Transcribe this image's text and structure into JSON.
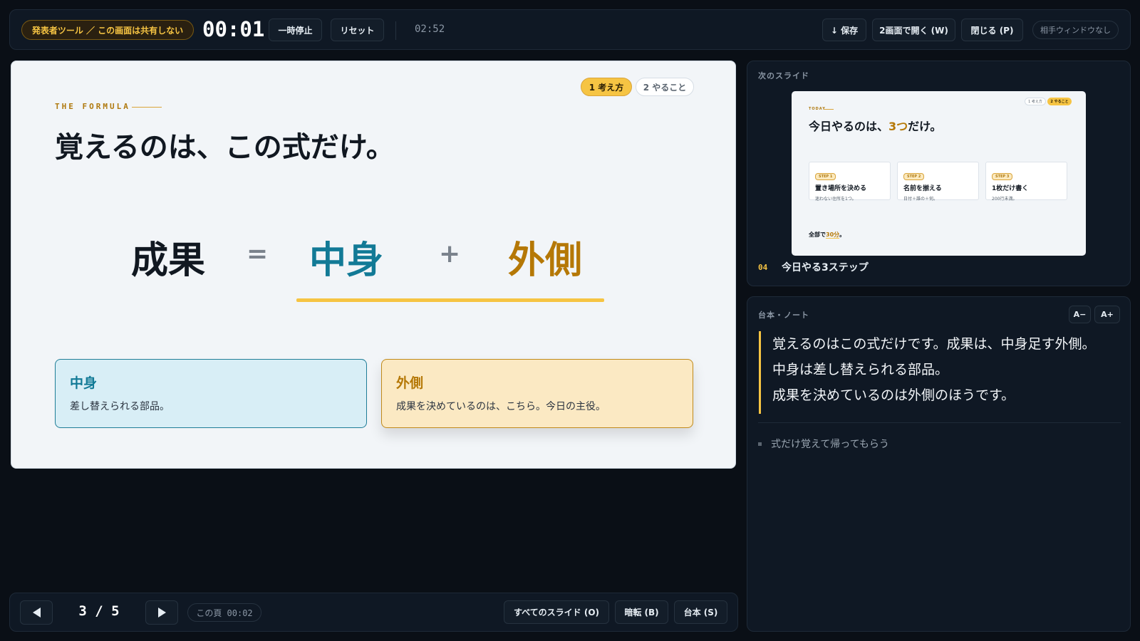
{
  "topbar": {
    "presenter_badge": "発表者ツール ／ この画面は共有しない",
    "timer": "00:01",
    "pause_label": "一時停止",
    "reset_label": "リセット",
    "elapsed": "02:52",
    "save_label": "↓ 保存",
    "open_two_screens_label": "2画面で開く (W)",
    "close_label": "閉じる (P)",
    "no_audience_window_label": "相手ウィンドウなし"
  },
  "slide": {
    "tabs": [
      {
        "label": "1 考え方",
        "active": true
      },
      {
        "label": "2 やること",
        "active": false
      }
    ],
    "kicker": "THE FORMULA",
    "title": "覚えるのは、この式だけ。",
    "formula": {
      "result": "成果",
      "equals": "=",
      "term1": "中身",
      "plus": "+",
      "term2": "外側"
    },
    "cards": [
      {
        "title": "中身",
        "text": "差し替えられる部品。"
      },
      {
        "title": "外側",
        "text": "成果を決めているのは、こちら。今日の主役。"
      }
    ]
  },
  "nav": {
    "prev_icon": "triangle-left-icon",
    "page_indicator": "3 / 5",
    "next_icon": "triangle-right-icon",
    "page_time": "この頁 00:02",
    "all_slides_label": "すべてのスライド (O)",
    "blackout_label": "暗転 (B)",
    "script_label": "台本 (S)"
  },
  "next_slide": {
    "label": "次のスライド",
    "number": "04",
    "title": "今日やる3ステップ",
    "preview": {
      "kicker": "TODAY",
      "tabs": [
        "1 考え方",
        "2 やること"
      ],
      "headline_pre": "今日やるのは、",
      "headline_accent": "3つ",
      "headline_post": "だけ。",
      "steps": [
        {
          "step": "STEP 1",
          "title": "置き場所を決める",
          "text": "迷わない住所を1つ。"
        },
        {
          "step": "STEP 2",
          "title": "名前を揃える",
          "text": "日付＋誰の＋何。"
        },
        {
          "step": "STEP 3",
          "title": "1枚だけ書く",
          "text": "200行未満。"
        }
      ],
      "footer_pre": "全部で",
      "footer_accent": "30分",
      "footer_post": "。"
    }
  },
  "notes": {
    "label": "台本・ノート",
    "font_smaller": "A−",
    "font_larger": "A+",
    "lines": [
      "覚えるのはこの式だけです。成果は、中身足す外側。",
      "中身は差し替えられる部品。",
      "成果を決めているのは外側のほうです。"
    ],
    "bullets": [
      "式だけ覚えて帰ってもらう"
    ]
  },
  "colors": {
    "accent_yellow": "#f6c443",
    "teal": "#127a96",
    "amber": "#b57806",
    "background": "#0a0f16"
  }
}
